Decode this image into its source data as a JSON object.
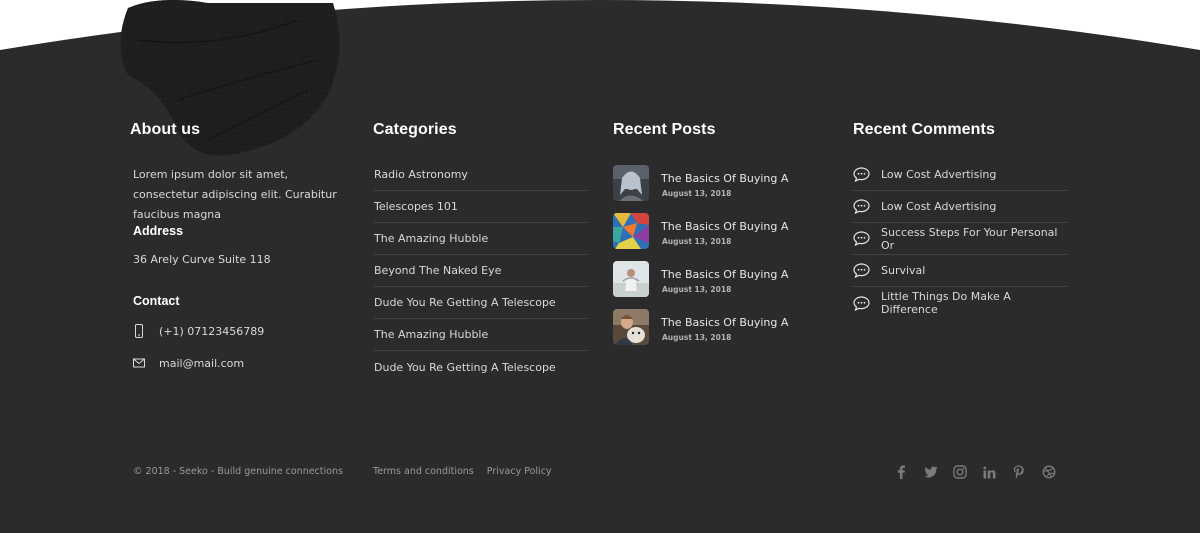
{
  "about": {
    "title": "About us",
    "text": "Lorem ipsum dolor sit amet, consectetur adipiscing elit. Curabitur faucibus magna",
    "address_title": "Address",
    "address": "36 Arely Curve Suite 118",
    "contact_title": "Contact",
    "phone": "(+1) 07123456789",
    "email": "mail@mail.com"
  },
  "categories": {
    "title": "Categories",
    "items": [
      "Radio Astronomy",
      "Telescopes 101",
      "The Amazing Hubble",
      "Beyond The Naked Eye",
      "Dude You Re Getting A Telescope",
      "The Amazing Hubble",
      "Dude You Re Getting A Telescope"
    ]
  },
  "recent_posts": {
    "title": "Recent Posts",
    "items": [
      {
        "title": "The Basics Of Buying A",
        "date": "August 13, 2018"
      },
      {
        "title": "The Basics Of Buying A",
        "date": "August 13, 2018"
      },
      {
        "title": "The Basics Of Buying A",
        "date": "August 13, 2018"
      },
      {
        "title": "The Basics Of Buying A",
        "date": "August 13, 2018"
      }
    ]
  },
  "recent_comments": {
    "title": "Recent Comments",
    "items": [
      "Low Cost Advertising",
      "Low Cost Advertising",
      "Success Steps For Your Personal Or",
      "Survival",
      "Little Things Do Make A Difference"
    ]
  },
  "bottom": {
    "copyright": "© 2018 - Seeko - Build genuine connections",
    "terms": "Terms and conditions",
    "privacy": "Privacy Policy"
  },
  "social_icons": [
    "facebook-icon",
    "twitter-icon",
    "instagram-icon",
    "linkedin-icon",
    "pinterest-icon",
    "dribbble-icon"
  ],
  "colors": {
    "background": "#2b2b2b",
    "text": "#d9d9d9",
    "divider": "#444444",
    "muted": "#9a9a9a"
  }
}
